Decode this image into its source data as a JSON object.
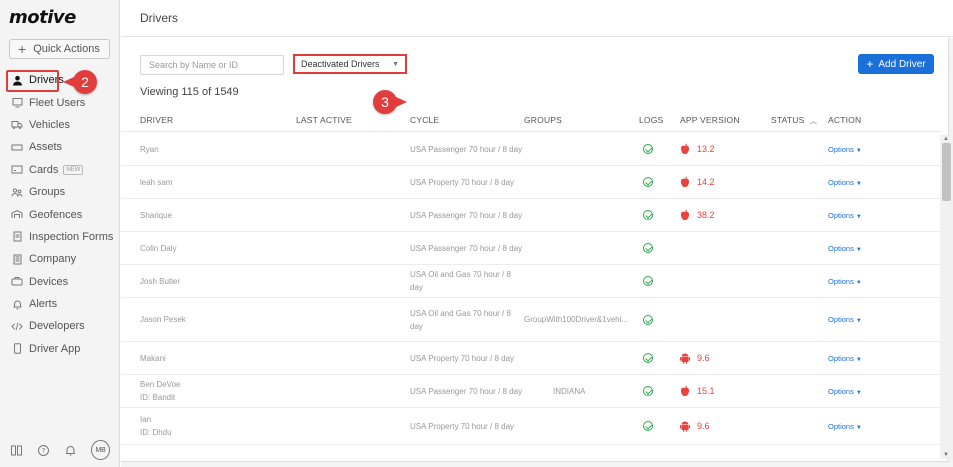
{
  "app": {
    "logo": "motive"
  },
  "sidebar": {
    "quick_actions": "Quick Actions",
    "items": [
      {
        "label": "Drivers",
        "icon": "person-icon",
        "active": true
      },
      {
        "label": "Fleet Users",
        "icon": "monitor-icon"
      },
      {
        "label": "Vehicles",
        "icon": "truck-icon"
      },
      {
        "label": "Assets",
        "icon": "trailer-icon"
      },
      {
        "label": "Cards",
        "icon": "card-icon",
        "badge": "NEW"
      },
      {
        "label": "Groups",
        "icon": "groups-icon"
      },
      {
        "label": "Geofences",
        "icon": "geofence-icon"
      },
      {
        "label": "Inspection Forms",
        "icon": "form-icon"
      },
      {
        "label": "Company",
        "icon": "building-icon"
      },
      {
        "label": "Devices",
        "icon": "device-icon"
      },
      {
        "label": "Alerts",
        "icon": "bell-icon"
      },
      {
        "label": "Developers",
        "icon": "code-icon"
      },
      {
        "label": "Driver App",
        "icon": "phone-icon"
      }
    ],
    "footer": {
      "avatar_initials": "MB"
    }
  },
  "header": {
    "title": "Drivers"
  },
  "toolbar": {
    "search_placeholder": "Search by Name or ID",
    "filter_value": "Deactivated Drivers",
    "add_driver": "Add Driver",
    "viewing": "Viewing 115 of 1549"
  },
  "annotations": {
    "step2": "2",
    "step3": "3"
  },
  "table": {
    "columns": {
      "driver": "DRIVER",
      "last_active": "LAST ACTIVE",
      "cycle": "CYCLE",
      "groups": "GROUPS",
      "logs": "LOGS",
      "app_version": "APP VERSION",
      "status": "STATUS",
      "action": "ACTION"
    },
    "status_sort_icon": "chevron-up-icon",
    "rows": [
      {
        "driver": "Ryan",
        "driver_id": "",
        "cycle": "USA Passenger 70 hour / 8 day",
        "groups": "",
        "logs": true,
        "os": "apple",
        "version": "13.2",
        "action": "Options"
      },
      {
        "driver": "leah sam",
        "driver_id": "",
        "cycle": "USA Property 70 hour / 8 day",
        "groups": "",
        "logs": true,
        "os": "apple",
        "version": "14.2",
        "action": "Options"
      },
      {
        "driver": "Sharique",
        "driver_id": "",
        "cycle": "USA Passenger 70 hour / 8 day",
        "groups": "",
        "logs": true,
        "os": "apple",
        "version": "38.2",
        "action": "Options"
      },
      {
        "driver": "Colin Daly",
        "driver_id": "",
        "cycle": "USA Passenger 70 hour / 8 day",
        "groups": "",
        "logs": true,
        "os": "",
        "version": "",
        "action": "Options"
      },
      {
        "driver": "Josh Butler",
        "driver_id": "",
        "cycle": "USA Oil and Gas 70 hour / 8",
        "cycle2": "day",
        "groups": "",
        "logs": true,
        "os": "",
        "version": "",
        "action": "Options"
      },
      {
        "driver": "Jason Pesek",
        "driver_id": "",
        "cycle": "USA Oil and Gas 70 hour / 8",
        "cycle2": "day",
        "groups": "GroupWith100Driver&1vehi...",
        "logs": true,
        "os": "",
        "version": "",
        "action": "Options"
      },
      {
        "driver": "Makani",
        "driver_id": "",
        "cycle": "USA Property 70 hour / 8 day",
        "groups": "",
        "logs": true,
        "os": "android",
        "version": "9.6",
        "action": "Options"
      },
      {
        "driver": "Ben DeVoe",
        "driver_id": "ID: Bandit",
        "cycle": "USA Passenger 70 hour / 8 day",
        "groups": "INDIANA",
        "logs": true,
        "os": "apple",
        "version": "15.1",
        "action": "Options"
      },
      {
        "driver": "Ian",
        "driver_id": "ID: Dhdu",
        "cycle": "USA Property 70 hour / 8 day",
        "groups": "",
        "logs": true,
        "os": "android",
        "version": "9.6",
        "action": "Options"
      }
    ]
  },
  "colors": {
    "accent": "#1a6fd8",
    "highlight": "#e03c3c",
    "check": "#2da84a",
    "app_version": "#e8433e"
  }
}
